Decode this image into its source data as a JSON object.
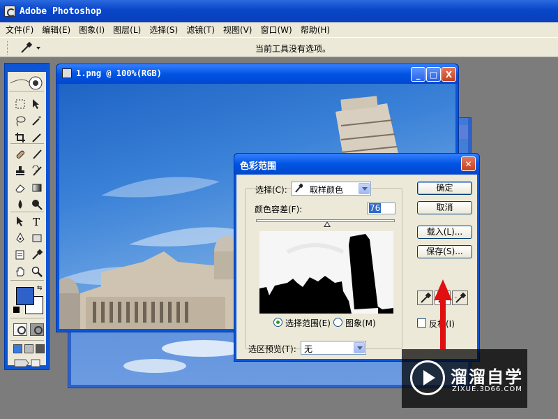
{
  "app": {
    "title": "Adobe Photoshop"
  },
  "menu": [
    {
      "label": "文件(F)"
    },
    {
      "label": "编辑(E)"
    },
    {
      "label": "图象(I)"
    },
    {
      "label": "图层(L)"
    },
    {
      "label": "选择(S)"
    },
    {
      "label": "滤镜(T)"
    },
    {
      "label": "视图(V)"
    },
    {
      "label": "窗口(W)"
    },
    {
      "label": "帮助(H)"
    }
  ],
  "options_bar": {
    "message": "当前工具没有选项。",
    "tool_icon": "eyedropper-icon"
  },
  "toolbox": {
    "tools": [
      "marquee-icon",
      "move-icon",
      "lasso-icon",
      "magic-wand-icon",
      "crop-icon",
      "slice-icon",
      "healing-brush-icon",
      "brush-icon",
      "clone-stamp-icon",
      "history-brush-icon",
      "eraser-icon",
      "gradient-icon",
      "blur-icon",
      "dodge-icon",
      "path-select-icon",
      "type-icon",
      "pen-icon",
      "rectangle-shape-icon",
      "notes-icon",
      "eyedropper-icon",
      "hand-icon",
      "zoom-icon"
    ],
    "foreground_color": "#2f62c9",
    "background_color": "#ffffff"
  },
  "document": {
    "title": "1.png @ 100%(RGB)",
    "buttons": [
      "_",
      "□",
      "X"
    ]
  },
  "dialog": {
    "title": "色彩范围",
    "select_label": "选择(C):",
    "select_value": "取样颜色",
    "fuzziness_label": "颜色容差(F):",
    "fuzziness_value": "76",
    "radio_selection": "选择范围(E)",
    "radio_image": "图象(M)",
    "preview_label": "选区预览(T):",
    "preview_value": "无",
    "btn_ok": "确定",
    "btn_cancel": "取消",
    "btn_load": "载入(L)...",
    "btn_save": "保存(S)...",
    "invert_label": "反相(I)",
    "invert_checked": false,
    "selected_radio": "selection"
  },
  "watermark": {
    "brand": "溜溜自学",
    "url": "ZIXUE.3D66.COM"
  }
}
